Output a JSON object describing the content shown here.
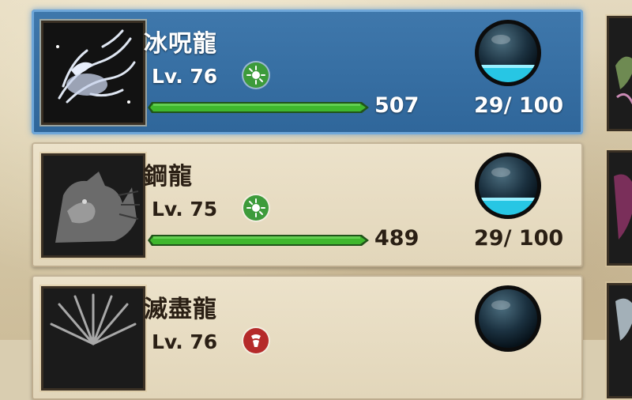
{
  "colors": {
    "selected_card": "#336c9f",
    "card": "#e7dcc2",
    "bar_green": "#3fb72d",
    "orb_cyan": "#27c6e4",
    "element_green": "#3d9b3b",
    "element_red": "#b52a2a"
  },
  "cards": [
    {
      "name": "冰呪龍",
      "level": "Lv. 76",
      "element_icon": "thunder-green-icon",
      "xp_value": "507",
      "xp_fill": 1.0,
      "counter": "29/ 100",
      "orb_fill": 0.3,
      "selected": true
    },
    {
      "name": "鋼龍",
      "level": "Lv. 75",
      "element_icon": "thunder-green-icon",
      "xp_value": "489",
      "xp_fill": 1.0,
      "counter": "29/ 100",
      "orb_fill": 0.3,
      "selected": false
    },
    {
      "name": "滅盡龍",
      "level": "Lv. 76",
      "element_icon": "dragon-red-icon",
      "selected": false
    }
  ]
}
